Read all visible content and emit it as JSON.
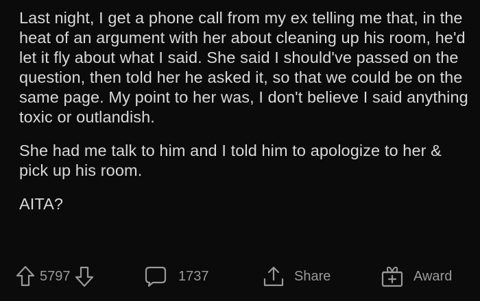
{
  "post": {
    "paragraphs": [
      "Last night, I get a phone call from my ex telling me that, in the heat of an argument with her about cleaning up his room, he'd let it fly about what I said. She said I should've passed on the question, then told her he asked it, so that we could be on the same page. My point to her was, I don't believe I said anything toxic or outlandish.",
      "She had me talk to him and I told him to apologize to her & pick up his room.",
      "AITA?"
    ]
  },
  "actions": {
    "votes": "5797",
    "comments": "1737",
    "share_label": "Share",
    "award_label": "Award"
  },
  "colors": {
    "background": "#0b0b0b",
    "text": "#d9d9d9",
    "muted": "#9a9a9a"
  },
  "icons": [
    "upvote-arrow-icon",
    "downvote-arrow-icon",
    "comment-bubble-icon",
    "share-icon",
    "award-gift-icon"
  ]
}
